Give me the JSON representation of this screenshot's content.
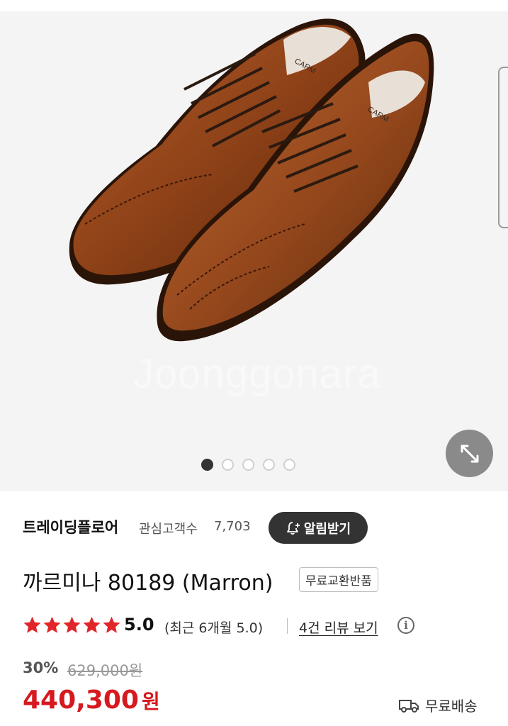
{
  "hero": {
    "watermark": "Joonggonara",
    "image_alt": "brown leather split-toe derby shoes",
    "slide_count": 5,
    "active_slide": 1
  },
  "seller": {
    "name": "트레이딩플로어",
    "watch_label": "관심고객수",
    "watch_count": "7,703",
    "alert_button": "알림받기"
  },
  "product": {
    "title": "까르미나 80189 (Marron)",
    "badge": "무료교환반품"
  },
  "rating": {
    "stars": 5,
    "score": "5.0",
    "recent": "(최근 6개월 5.0)",
    "review_link": "4건 리뷰 보기"
  },
  "price": {
    "discount": "30%",
    "original": "629,000원",
    "sale": "440,300",
    "currency": "원"
  },
  "shipping": {
    "label": "무료배송",
    "icon": "truck-icon"
  },
  "colors": {
    "accent_red": "#d6191f",
    "dark_button": "#333333",
    "star_red": "#e0262b"
  }
}
